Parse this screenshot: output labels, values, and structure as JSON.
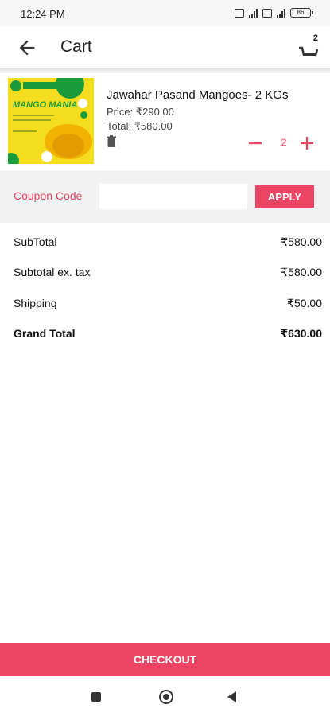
{
  "status_bar": {
    "time": "12:24 PM",
    "battery": "86"
  },
  "app_bar": {
    "title": "Cart",
    "cart_badge": "2"
  },
  "cart_item": {
    "image_caption": "MANGO MANIA",
    "name": "Jawahar Pasand Mangoes- 2 KGs",
    "price": "Price: ₹290.00",
    "total": "Total: ₹580.00",
    "quantity": "2"
  },
  "coupon": {
    "label": "Coupon Code",
    "input_value": "",
    "apply_label": "APPLY"
  },
  "summary": [
    {
      "label": "SubTotal",
      "value": "₹580.00",
      "bold": false
    },
    {
      "label": "Subtotal ex. tax",
      "value": "₹580.00",
      "bold": false
    },
    {
      "label": "Shipping",
      "value": "₹50.00",
      "bold": false
    },
    {
      "label": "Grand Total",
      "value": "₹630.00",
      "bold": true
    }
  ],
  "checkout_label": "CHECKOUT",
  "colors": {
    "accent": "#ec4463",
    "accent_text": "#e8455f",
    "coupon_bg": "#f2f2f2"
  },
  "icons": [
    "arrow-back-icon",
    "cart-icon",
    "trash-icon",
    "minus-icon",
    "plus-icon",
    "nav-recents-icon",
    "nav-home-icon",
    "nav-back-icon"
  ]
}
